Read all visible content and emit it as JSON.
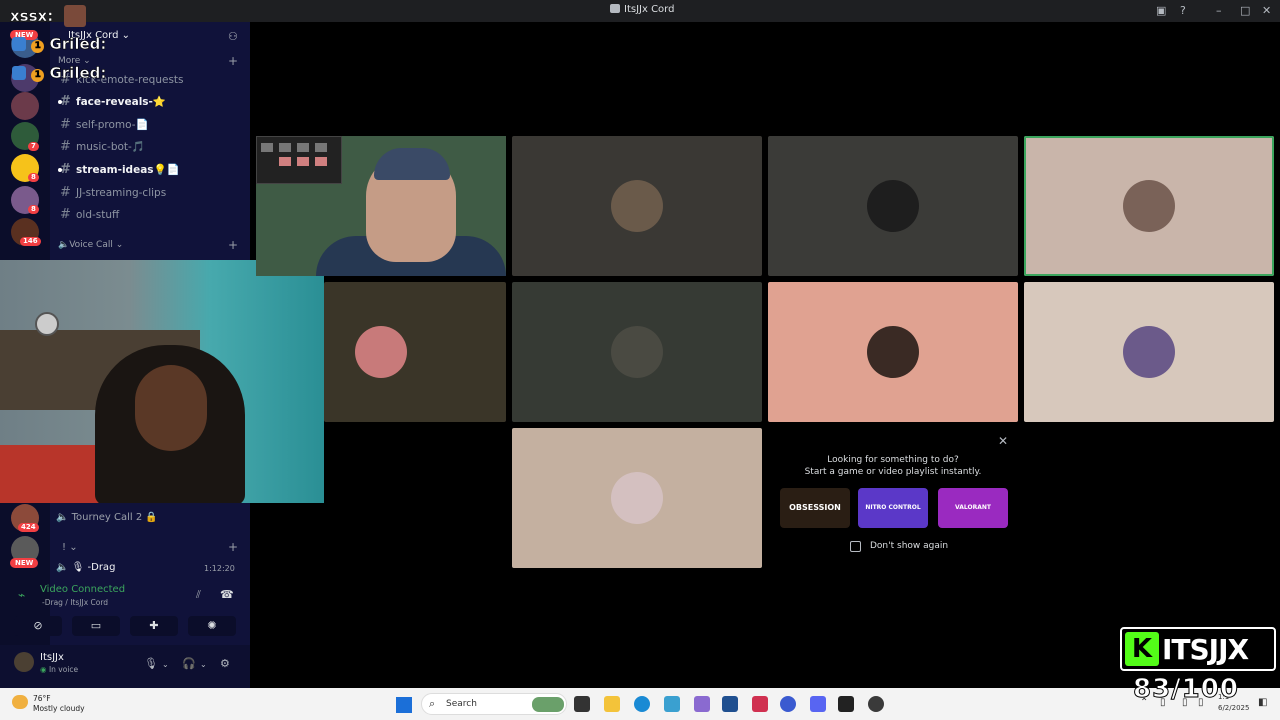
{
  "window": {
    "title": "ItsJJx Cord"
  },
  "overlay": {
    "xssx_label": "xssx:",
    "griled_lines": [
      "Griled:",
      "Griled:"
    ],
    "griled_count": "1"
  },
  "rail": {
    "new_tag": "NEW",
    "badges": [
      "7",
      "8",
      "8",
      "146",
      "424"
    ]
  },
  "sidebar": {
    "guild_name": "ItsJJx Cord",
    "more_label": "More",
    "channels": [
      {
        "name": "kick-emote-requests",
        "unread": false
      },
      {
        "name": "face-reveals-⭐",
        "unread": true
      },
      {
        "name": "self-promo-📄",
        "unread": false
      },
      {
        "name": "music-bot-🎵",
        "unread": false
      },
      {
        "name": "stream-ideas💡📄",
        "unread": true
      },
      {
        "name": "JJ-streaming-clips",
        "unread": false
      },
      {
        "name": "old-stuff",
        "unread": false
      }
    ],
    "voice_category": "Voice Call",
    "bottom_voice": {
      "tourney": "Tourney Call 2 🔒",
      "category": "!",
      "active_channel": "-Drag",
      "active_time": "1:12:20"
    }
  },
  "voice_status": {
    "title": "Video Connected",
    "subtitle": "-Drag / ItsJJx Cord",
    "buttons": [
      "camera-off",
      "screen-share",
      "activities",
      "soundboard"
    ]
  },
  "user": {
    "name": "ItsJJx",
    "status": "In voice"
  },
  "activity": {
    "line1": "Looking for something to do?",
    "line2": "Start a game or video playlist instantly.",
    "cards": [
      "OBSESSION",
      "NITRO CONTROL",
      "VALORANT"
    ],
    "checkbox_label": "Don't show again"
  },
  "brand": {
    "letter": "K",
    "text": "ITSJJX",
    "counter": "83/100"
  },
  "taskbar": {
    "temp": "76°F",
    "condition": "Mostly cloudy",
    "search_placeholder": "Search",
    "clock_time": "1:1",
    "clock_date": "6/2/2025"
  },
  "colors": {
    "sidebar_bg": "#10123a",
    "rail_bg": "#0b0d2a",
    "connected_green": "#3ba55d",
    "kick_green": "#53fc18"
  }
}
